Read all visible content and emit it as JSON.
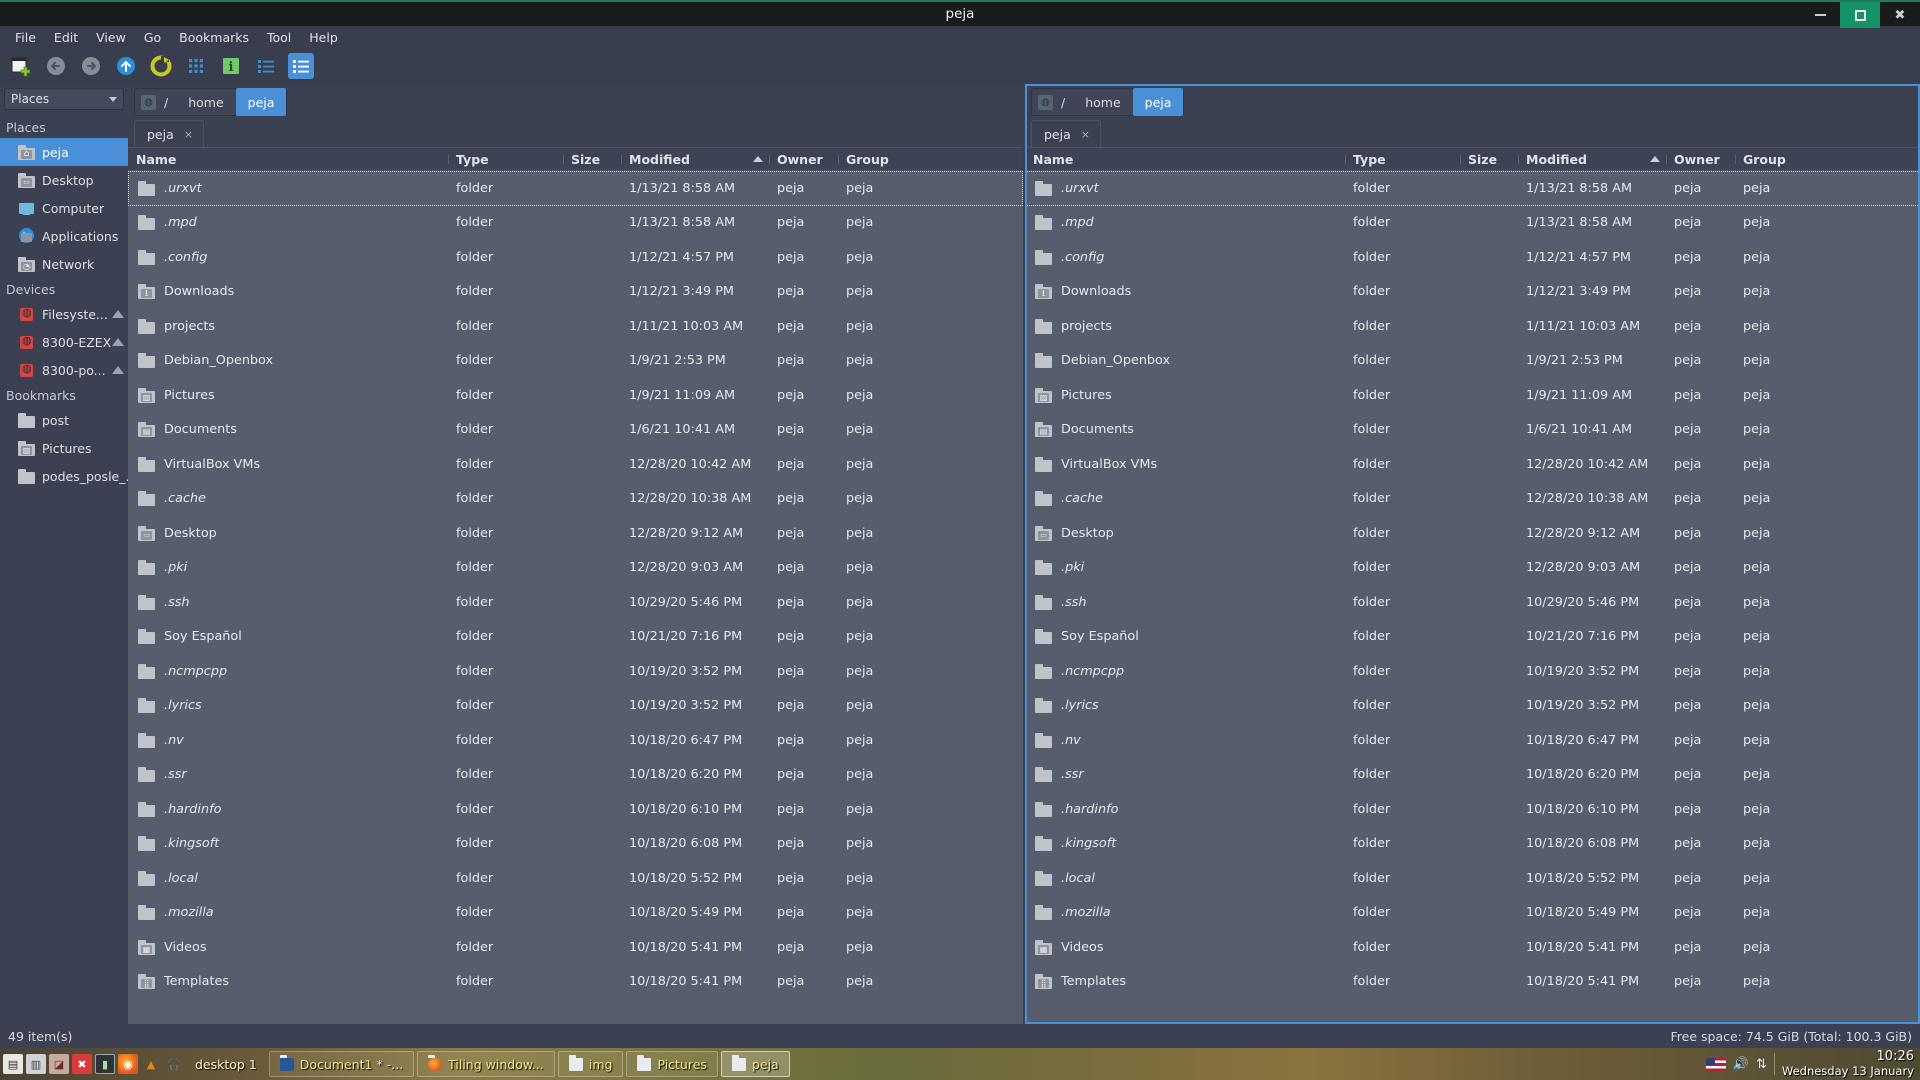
{
  "window": {
    "title": "peja",
    "minimize": "–",
    "maximize": "□",
    "close": "✖"
  },
  "menubar": {
    "items": [
      "File",
      "Edit",
      "View",
      "Go",
      "Bookmarks",
      "Tool",
      "Help"
    ]
  },
  "toolbar": {
    "items": [
      {
        "name": "new-tab-icon",
        "glyph": "▤"
      },
      {
        "name": "back-icon",
        "glyph": "←"
      },
      {
        "name": "forward-icon",
        "glyph": "→"
      },
      {
        "name": "up-icon",
        "glyph": "↑"
      },
      {
        "name": "reload-icon",
        "glyph": "⟳"
      },
      {
        "name": "icon-view-icon",
        "glyph": "⣿"
      },
      {
        "name": "info-icon",
        "glyph": "i"
      },
      {
        "name": "compact-view-icon",
        "glyph": "☰"
      },
      {
        "name": "detailed-list-view-icon",
        "glyph": "☰"
      }
    ]
  },
  "sidebar": {
    "combo_label": "Places",
    "groups": [
      {
        "title": "Places",
        "items": [
          {
            "label": "peja",
            "icon": "home-folder-icon",
            "selected": true,
            "eject": false
          },
          {
            "label": "Desktop",
            "icon": "desktop-folder-icon",
            "selected": false,
            "eject": false
          },
          {
            "label": "Computer",
            "icon": "computer-icon",
            "selected": false,
            "eject": false
          },
          {
            "label": "Applications",
            "icon": "applications-icon",
            "selected": false,
            "eject": false
          },
          {
            "label": "Network",
            "icon": "network-folder-icon",
            "selected": false,
            "eject": false
          }
        ]
      },
      {
        "title": "Devices",
        "items": [
          {
            "label": "Filesyste...",
            "icon": "harddisk-icon",
            "selected": false,
            "eject": true
          },
          {
            "label": "8300-EZEX",
            "icon": "harddisk-icon",
            "selected": false,
            "eject": true
          },
          {
            "label": "8300-po...",
            "icon": "harddisk-icon",
            "selected": false,
            "eject": true
          }
        ]
      },
      {
        "title": "Bookmarks",
        "items": [
          {
            "label": "post",
            "icon": "folder-icon",
            "selected": false,
            "eject": false
          },
          {
            "label": "Pictures",
            "icon": "pictures-folder-icon",
            "selected": false,
            "eject": false
          },
          {
            "label": "podes_posle_...",
            "icon": "folder-icon",
            "selected": false,
            "eject": false
          }
        ]
      }
    ]
  },
  "panes": [
    {
      "focused": false,
      "path": {
        "root": "/",
        "crumbs": [
          "home",
          "peja"
        ],
        "current": "peja"
      },
      "tab": {
        "label": "peja",
        "close": "×"
      },
      "columns": [
        "Name",
        "Type",
        "Size",
        "Modified",
        "Owner",
        "Group"
      ],
      "sort_column": "Modified",
      "sort_direction": "asc"
    },
    {
      "focused": true,
      "path": {
        "root": "/",
        "crumbs": [
          "home",
          "peja"
        ],
        "current": "peja"
      },
      "tab": {
        "label": "peja",
        "close": "×"
      },
      "columns": [
        "Name",
        "Type",
        "Size",
        "Modified",
        "Owner",
        "Group"
      ],
      "sort_column": "Modified",
      "sort_direction": "asc"
    }
  ],
  "files": [
    {
      "name": ".urxvt",
      "hidden": true,
      "icon": "folder-icon",
      "type": "folder",
      "size": "",
      "modified": "1/13/21 8:58 AM",
      "owner": "peja",
      "group": "peja"
    },
    {
      "name": ".mpd",
      "hidden": true,
      "icon": "folder-icon",
      "type": "folder",
      "size": "",
      "modified": "1/13/21 8:58 AM",
      "owner": "peja",
      "group": "peja"
    },
    {
      "name": ".config",
      "hidden": true,
      "icon": "folder-icon",
      "type": "folder",
      "size": "",
      "modified": "1/12/21 4:57 PM",
      "owner": "peja",
      "group": "peja"
    },
    {
      "name": "Downloads",
      "hidden": false,
      "icon": "downloads-folder-icon",
      "type": "folder",
      "size": "",
      "modified": "1/12/21 3:49 PM",
      "owner": "peja",
      "group": "peja"
    },
    {
      "name": "projects",
      "hidden": false,
      "icon": "folder-icon",
      "type": "folder",
      "size": "",
      "modified": "1/11/21 10:03 AM",
      "owner": "peja",
      "group": "peja"
    },
    {
      "name": "Debian_Openbox",
      "hidden": false,
      "icon": "folder-icon",
      "type": "folder",
      "size": "",
      "modified": "1/9/21 2:53 PM",
      "owner": "peja",
      "group": "peja"
    },
    {
      "name": "Pictures",
      "hidden": false,
      "icon": "pictures-folder-icon",
      "type": "folder",
      "size": "",
      "modified": "1/9/21 11:09 AM",
      "owner": "peja",
      "group": "peja"
    },
    {
      "name": "Documents",
      "hidden": false,
      "icon": "documents-folder-icon",
      "type": "folder",
      "size": "",
      "modified": "1/6/21 10:41 AM",
      "owner": "peja",
      "group": "peja"
    },
    {
      "name": "VirtualBox VMs",
      "hidden": false,
      "icon": "folder-icon",
      "type": "folder",
      "size": "",
      "modified": "12/28/20 10:42 AM",
      "owner": "peja",
      "group": "peja"
    },
    {
      "name": ".cache",
      "hidden": true,
      "icon": "folder-icon",
      "type": "folder",
      "size": "",
      "modified": "12/28/20 10:38 AM",
      "owner": "peja",
      "group": "peja"
    },
    {
      "name": "Desktop",
      "hidden": false,
      "icon": "desktop-folder-icon",
      "type": "folder",
      "size": "",
      "modified": "12/28/20 9:12 AM",
      "owner": "peja",
      "group": "peja"
    },
    {
      "name": ".pki",
      "hidden": true,
      "icon": "folder-icon",
      "type": "folder",
      "size": "",
      "modified": "12/28/20 9:03 AM",
      "owner": "peja",
      "group": "peja"
    },
    {
      "name": ".ssh",
      "hidden": true,
      "icon": "folder-icon",
      "type": "folder",
      "size": "",
      "modified": "10/29/20 5:46 PM",
      "owner": "peja",
      "group": "peja"
    },
    {
      "name": "Soy Español",
      "hidden": false,
      "icon": "folder-icon",
      "type": "folder",
      "size": "",
      "modified": "10/21/20 7:16 PM",
      "owner": "peja",
      "group": "peja"
    },
    {
      "name": ".ncmpcpp",
      "hidden": true,
      "icon": "folder-icon",
      "type": "folder",
      "size": "",
      "modified": "10/19/20 3:52 PM",
      "owner": "peja",
      "group": "peja"
    },
    {
      "name": ".lyrics",
      "hidden": true,
      "icon": "folder-icon",
      "type": "folder",
      "size": "",
      "modified": "10/19/20 3:52 PM",
      "owner": "peja",
      "group": "peja"
    },
    {
      "name": ".nv",
      "hidden": true,
      "icon": "folder-icon",
      "type": "folder",
      "size": "",
      "modified": "10/18/20 6:47 PM",
      "owner": "peja",
      "group": "peja"
    },
    {
      "name": ".ssr",
      "hidden": true,
      "icon": "folder-icon",
      "type": "folder",
      "size": "",
      "modified": "10/18/20 6:20 PM",
      "owner": "peja",
      "group": "peja"
    },
    {
      "name": ".hardinfo",
      "hidden": true,
      "icon": "folder-icon",
      "type": "folder",
      "size": "",
      "modified": "10/18/20 6:10 PM",
      "owner": "peja",
      "group": "peja"
    },
    {
      "name": ".kingsoft",
      "hidden": true,
      "icon": "folder-icon",
      "type": "folder",
      "size": "",
      "modified": "10/18/20 6:08 PM",
      "owner": "peja",
      "group": "peja"
    },
    {
      "name": ".local",
      "hidden": true,
      "icon": "folder-icon",
      "type": "folder",
      "size": "",
      "modified": "10/18/20 5:52 PM",
      "owner": "peja",
      "group": "peja"
    },
    {
      "name": ".mozilla",
      "hidden": true,
      "icon": "folder-icon",
      "type": "folder",
      "size": "",
      "modified": "10/18/20 5:49 PM",
      "owner": "peja",
      "group": "peja"
    },
    {
      "name": "Videos",
      "hidden": false,
      "icon": "videos-folder-icon",
      "type": "folder",
      "size": "",
      "modified": "10/18/20 5:41 PM",
      "owner": "peja",
      "group": "peja"
    },
    {
      "name": "Templates",
      "hidden": false,
      "icon": "templates-folder-icon",
      "type": "folder",
      "size": "",
      "modified": "10/18/20 5:41 PM",
      "owner": "peja",
      "group": "peja"
    }
  ],
  "statusbar": {
    "left": "49 item(s)",
    "right": "Free space: 74.5 GiB (Total: 100.3 GiB)"
  },
  "taskbar": {
    "tray_icons": [
      "text-editor-icon",
      "file-manager-icon",
      "package-icon",
      "x-app-icon",
      "terminal-icon",
      "firefox-icon",
      "vlc-icon",
      "headphones-icon"
    ],
    "desktop_label": "desktop 1",
    "tasks": [
      {
        "label": "Document1 * -...",
        "icon": "writer-icon",
        "active": false
      },
      {
        "label": "Tiling window...",
        "icon": "firefox-icon",
        "active": false
      },
      {
        "label": "img",
        "icon": "folder-icon",
        "active": false
      },
      {
        "label": "Pictures",
        "icon": "folder-icon",
        "active": false
      },
      {
        "label": "peja",
        "icon": "folder-icon",
        "active": true
      }
    ],
    "clock_time": "10:26",
    "clock_date": "Wednesday 13 January",
    "tray_right": [
      "keyboard-flag-icon",
      "volume-icon",
      "network-icon"
    ]
  },
  "colors": {
    "accent": "#4a90d9",
    "titlebar": "#1b1b1b",
    "chrome": "#3b4152",
    "list_bg": "#565d6d",
    "maximize": "#159366"
  }
}
